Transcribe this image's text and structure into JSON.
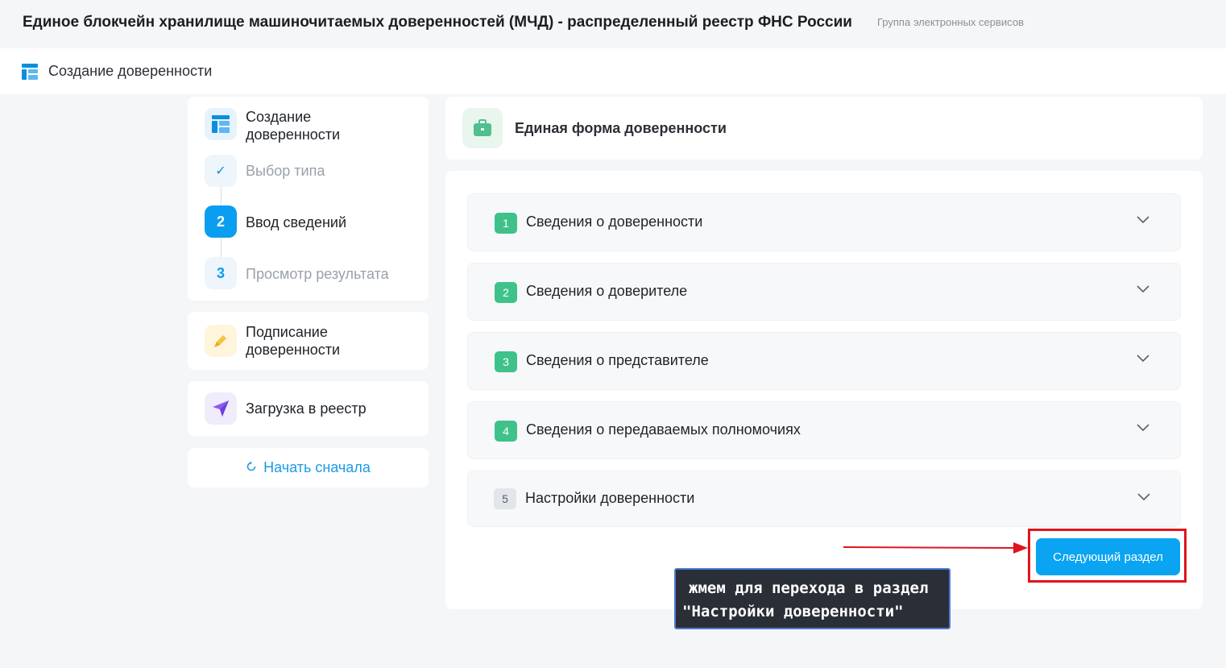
{
  "header": {
    "title": "Единое блокчейн хранилище машиночитаемых доверенностей (МЧД) - распределенный реестр ФНС России",
    "subtitle": "Группа электронных сервисов"
  },
  "page": {
    "title": "Создание доверенности",
    "icon": "form-layout-icon"
  },
  "sidebar": {
    "create": {
      "title": "Создание доверенности",
      "icon": "form-layout-icon",
      "steps": [
        {
          "marker": "✓",
          "label": "Выбор типа",
          "state": "done"
        },
        {
          "marker": "2",
          "label": "Ввод сведений",
          "state": "active"
        },
        {
          "marker": "3",
          "label": "Просмотр результата",
          "state": "pending"
        }
      ]
    },
    "sign": {
      "title": "Подписание доверенности",
      "icon": "pen-icon"
    },
    "upload": {
      "title": "Загрузка в реестр",
      "icon": "send-icon"
    },
    "restart": {
      "label": "Начать сначала",
      "icon": "refresh-icon"
    }
  },
  "form": {
    "header_title": "Единая форма доверенности",
    "header_icon": "briefcase-icon",
    "sections": [
      {
        "number": "1",
        "label": "Сведения о доверенности",
        "status": "filled"
      },
      {
        "number": "2",
        "label": "Сведения о доверителе",
        "status": "filled"
      },
      {
        "number": "3",
        "label": "Сведения о представителе",
        "status": "filled"
      },
      {
        "number": "4",
        "label": "Сведения о передаваемых полномочиях",
        "status": "filled"
      },
      {
        "number": "5",
        "label": "Настройки доверенности",
        "status": "empty"
      }
    ],
    "next_button": "Следующий раздел"
  },
  "annotation": {
    "line1": "жмем для перехода в раздел",
    "line2": "\"Настройки доверенности\""
  },
  "colors": {
    "accent": "#0aa4f2",
    "success": "#3fc28a",
    "highlight": "#e0141e",
    "tooltip_bg": "#2a2e36"
  }
}
